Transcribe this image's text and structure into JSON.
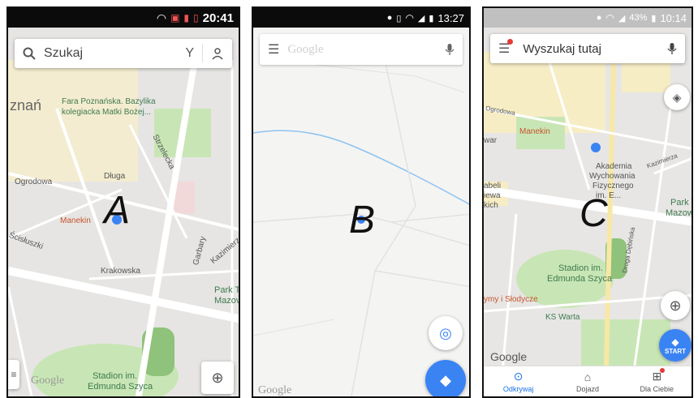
{
  "panel_a": {
    "time": "20:41",
    "search_placeholder": "Szukaj",
    "letter": "A",
    "labels": {
      "poznan": "znań",
      "fara_line1": "Fara Poznańska. Bazylika",
      "fara_line2": "kolegiacka Matki Bożej...",
      "ogrodowa": "Ogrodowa",
      "dluga": "Długa",
      "strzelecka": "Strzelecka",
      "manekin": "Manekin",
      "krakowska": "Krakowska",
      "garbary": "Garbary",
      "kazimierz": "Kazimierz",
      "park_line1": "Park T",
      "park_line2": "Mazov",
      "stadion_line1": "Stadion im.",
      "stadion_line2": "Edmunda Szyca",
      "google": "Google",
      "scisluszki": "Ścisłuszki"
    }
  },
  "panel_b": {
    "time": "13:27",
    "search_placeholder": "Google",
    "letter": "B",
    "google": "Google"
  },
  "panel_c": {
    "time": "10:14",
    "battery": "43%",
    "search_placeholder": "Wyszukaj tutaj",
    "letter": "C",
    "start_label": "START",
    "labels": {
      "ogrodowa": "Ogrodowa",
      "war": "war",
      "manekin": "Manekin",
      "akademia_line1": "Akademia",
      "akademia_line2": "Wychowania",
      "akademia_line3": "Fizycznego",
      "akademia_line4": "im. E...",
      "abeli": "abeli",
      "iewa": "iewa",
      "kich": "kich",
      "park_line1": "Park Ta",
      "park_line2": "Mazowi",
      "stadion_line1": "Stadion im.",
      "stadion_line2": "Edmunda Szyca",
      "slodycze": "ymy i Słodycze",
      "ks_warta": "KS Warta",
      "kazimierza": "Kazimierza",
      "droga_debinska": "Droga Dębińska",
      "google": "Google"
    },
    "nav": [
      {
        "label": "Odkrywaj",
        "active": true
      },
      {
        "label": "Dojazd",
        "active": false
      },
      {
        "label": "Dla Ciebie",
        "active": false
      }
    ]
  },
  "colors": {
    "map_grey": "#e9e8e6",
    "map_yellow": "#f7edc7",
    "park_green": "#c8e6b5",
    "road_white": "#ffffff",
    "accent_blue": "#3a83f3",
    "water_blue": "#8ec3f0"
  }
}
